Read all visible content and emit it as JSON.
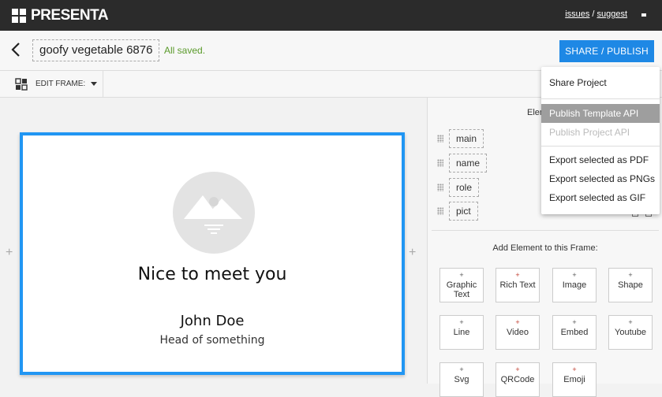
{
  "topbar": {
    "logo_text": "PRESENTA",
    "issues_link": "issues",
    "separator": "/",
    "suggest_link": "suggest"
  },
  "header": {
    "project_name": "goofy vegetable 6876",
    "save_status": "All saved.",
    "share_button": "SHARE / PUBLISH"
  },
  "toolbar": {
    "edit_frame_label": "EDIT FRAME:"
  },
  "canvas": {
    "heading": "Nice to meet you",
    "name": "John Doe",
    "role": "Head of something",
    "add_left": "+",
    "add_right": "+"
  },
  "panel": {
    "title": "Elem",
    "elements": [
      "main",
      "name",
      "role",
      "pict"
    ],
    "add_title": "Add Element to this Frame:",
    "tiles": [
      {
        "label": "Graphic Text"
      },
      {
        "label": "Rich Text"
      },
      {
        "label": "Image"
      },
      {
        "label": "Shape"
      },
      {
        "label": "Line"
      },
      {
        "label": "Video"
      },
      {
        "label": "Embed"
      },
      {
        "label": "Youtube"
      },
      {
        "label": "Svg"
      },
      {
        "label": "QRCode"
      },
      {
        "label": "Emoji"
      }
    ]
  },
  "dropdown": {
    "items": [
      {
        "label": "Share Project",
        "state": "normal"
      },
      {
        "label": "Publish Template API",
        "state": "active"
      },
      {
        "label": "Publish Project API",
        "state": "disabled"
      },
      {
        "label": "Export selected as PDF",
        "state": "normal"
      },
      {
        "label": "Export selected as PNGs",
        "state": "normal"
      },
      {
        "label": "Export selected as GIF",
        "state": "normal"
      }
    ]
  },
  "colors": {
    "accent": "#1e88e5",
    "frame_border": "#2196f3",
    "topbar": "#2b2b2b",
    "saved_text": "#5a9a2a",
    "menu_active": "#9e9e9e"
  }
}
